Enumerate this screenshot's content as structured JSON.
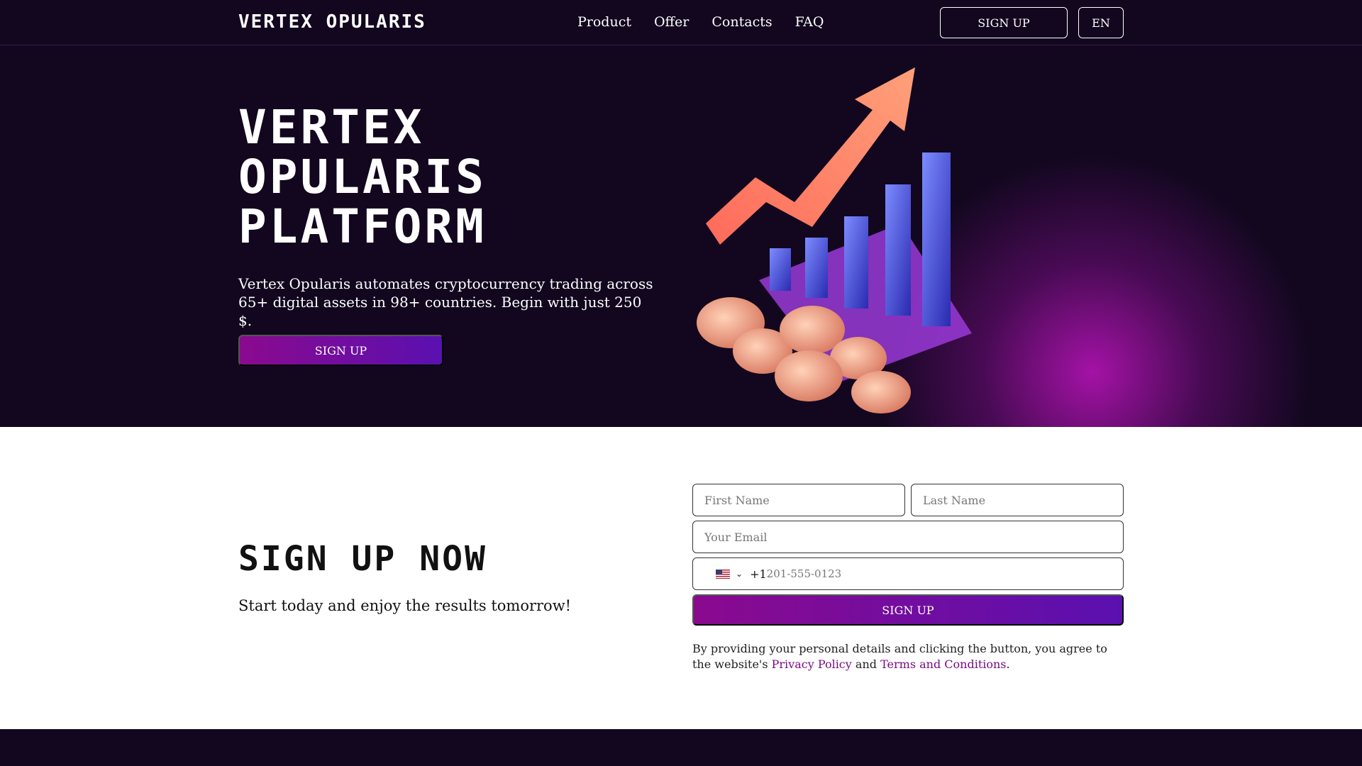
{
  "header": {
    "logo": "Vertex Opularis",
    "nav": [
      "Product",
      "Offer",
      "Contacts",
      "FAQ"
    ],
    "signup_label": "SIGN UP",
    "lang_label": "EN"
  },
  "hero": {
    "title_lines": [
      "Vertex",
      "Opularis",
      "Platform"
    ],
    "subtitle": "Vertex Opularis automates cryptocurrency trading across 65+ digital assets in 98+ countries. Begin with just 250 $.",
    "cta_label": "SIGN UP"
  },
  "signup": {
    "title": "Sign up now",
    "subtitle": "Start today and enjoy the results tomorrow!",
    "first_name_placeholder": "First Name",
    "last_name_placeholder": "Last Name",
    "email_placeholder": "Your Email",
    "phone_code": "+1",
    "phone_placeholder": "201-555-0123",
    "submit_label": "SIGN UP",
    "terms_prefix": "By providing your personal details and clicking the button, you agree to the website's",
    "privacy_link": "Privacy Policy",
    "terms_and": "and",
    "terms_link": "Terms and Conditions",
    "terms_suffix": "."
  },
  "colors": {
    "background": "#12071f",
    "accent_start": "#8a0a8e",
    "accent_end": "#5a10b0",
    "link": "#7a0c84"
  }
}
